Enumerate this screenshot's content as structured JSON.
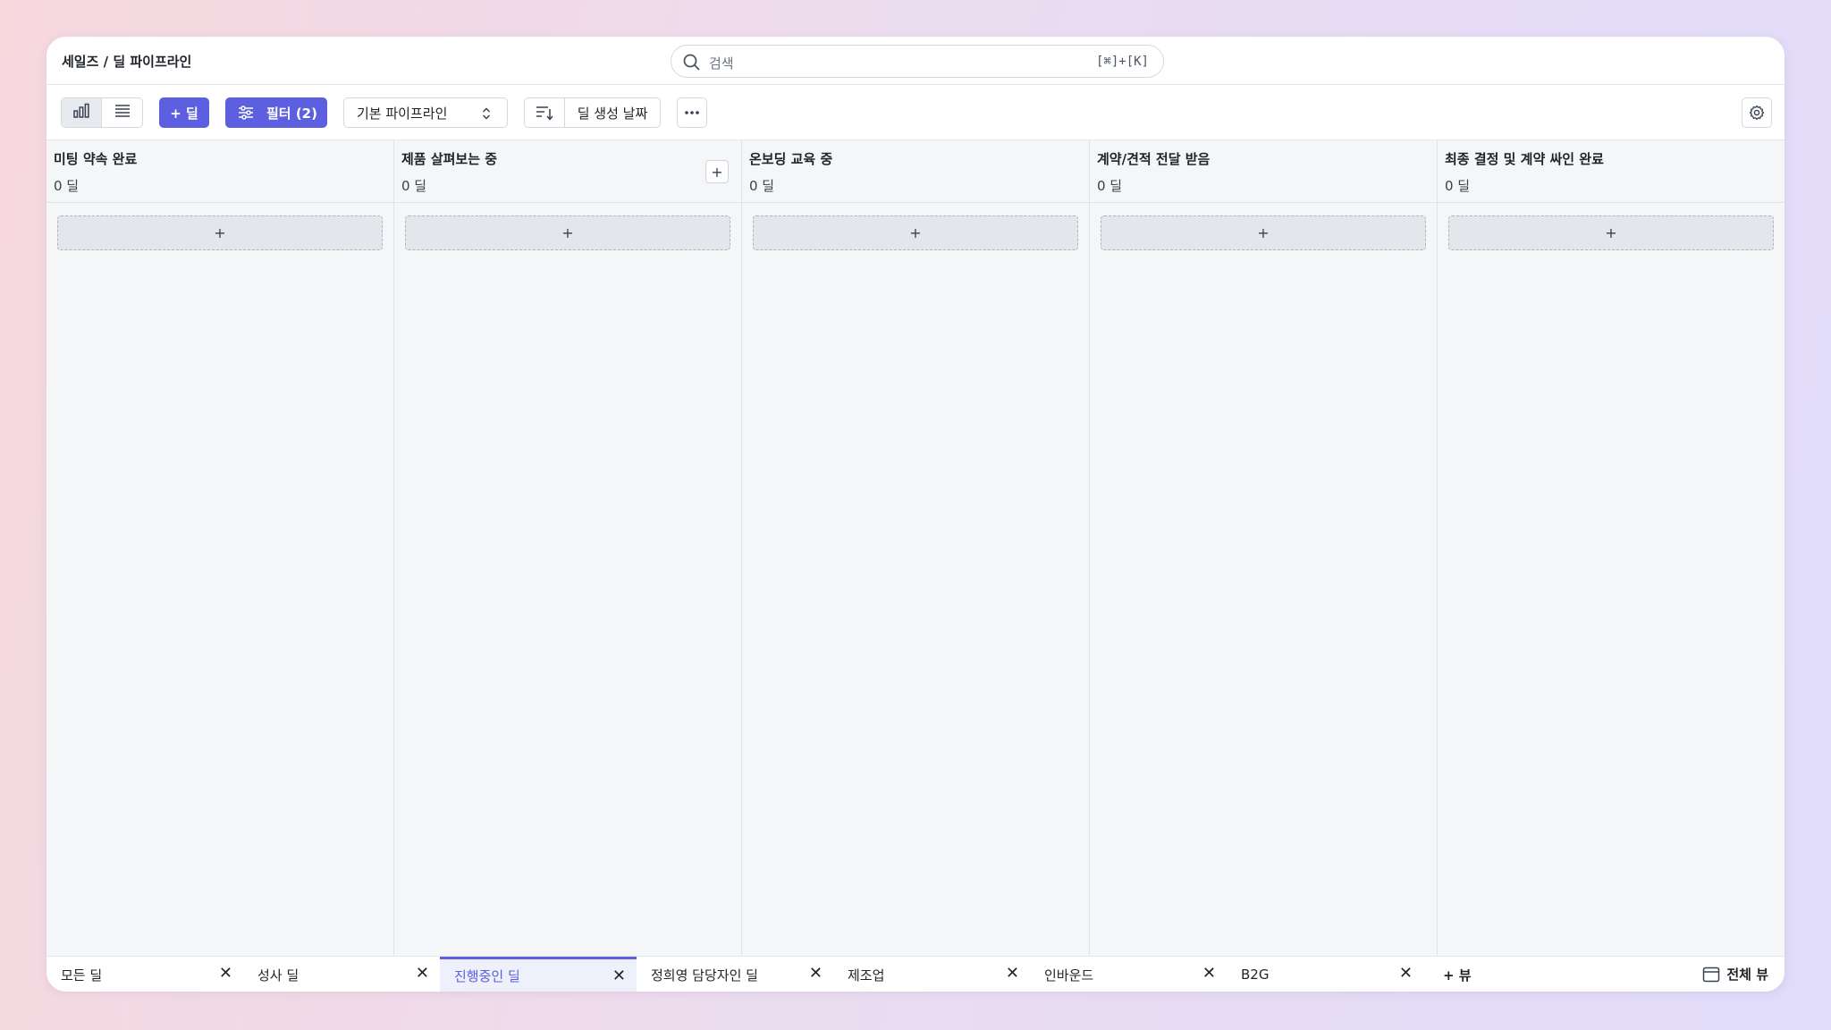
{
  "header": {
    "breadcrumb": "세일즈 / 딜 파이프라인",
    "search_placeholder": "검색",
    "search_shortcut": "[⌘]+[K]"
  },
  "toolbar": {
    "view_chart_icon": "bar-chart-icon",
    "view_list_icon": "list-icon",
    "add_deal_label": "+ 딜",
    "filter_label": "필터 (2)",
    "pipeline_select": "기본 파이프라인",
    "sort_label": "딜 생성 날짜",
    "more_icon": "ellipsis-icon",
    "settings_icon": "gear-icon",
    "accent_color": "#5b5fe0"
  },
  "columns": [
    {
      "title": "미팅 약속 완료",
      "count": "0 딜"
    },
    {
      "title": "제품 살펴보는 중",
      "count": "0 딜"
    },
    {
      "title": "온보딩 교육 중",
      "count": "0 딜"
    },
    {
      "title": "계약/견적 전달 받음",
      "count": "0 딜"
    },
    {
      "title": "최종 결정 및 계약 싸인 완료",
      "count": "0 딜"
    }
  ],
  "add_card_label": "+",
  "tabs": [
    {
      "label": "모든 딜",
      "close": "✕"
    },
    {
      "label": "성사 딜",
      "close": "✕"
    },
    {
      "label": "진행중인 딜",
      "close": "✕",
      "active": true
    },
    {
      "label": "정희영 담당자인 딜",
      "close": "✕"
    },
    {
      "label": "제조업",
      "close": "✕"
    },
    {
      "label": "인바운드",
      "close": "✕"
    },
    {
      "label": "B2G",
      "close": "✕"
    }
  ],
  "add_view_label": "+ 뷰",
  "full_view_label": "전체 뷰"
}
